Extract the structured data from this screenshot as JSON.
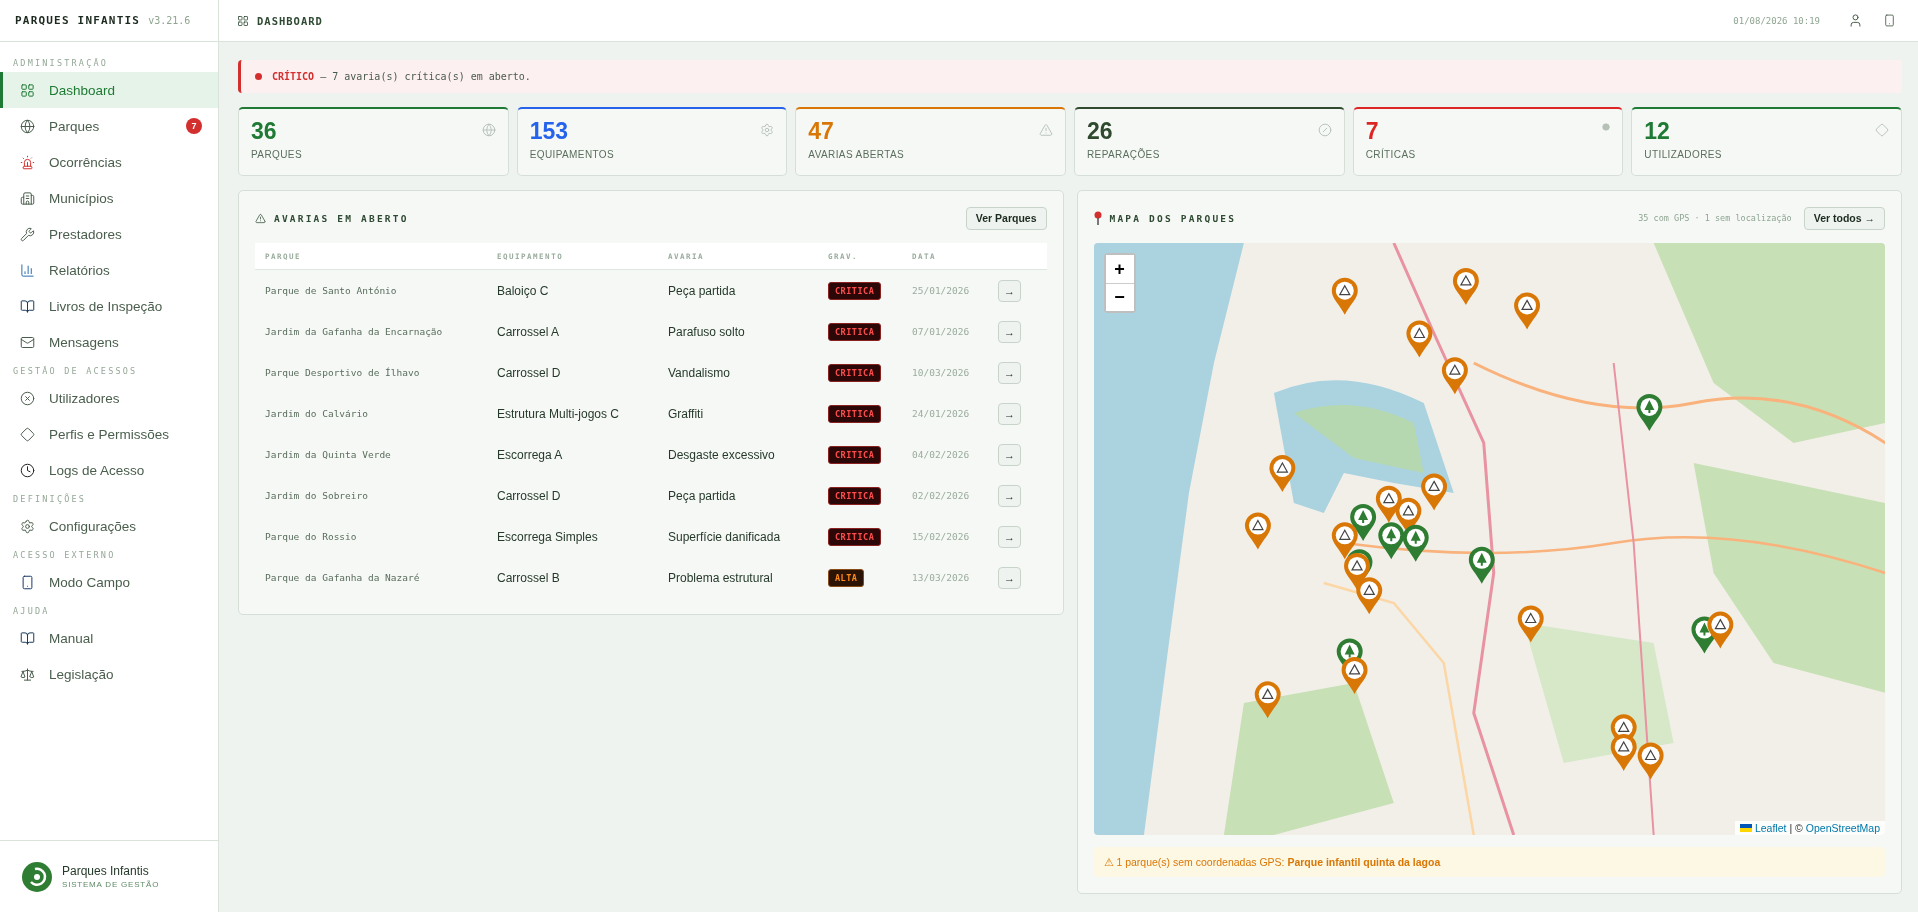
{
  "brand": {
    "title": "PARQUES INFANTIS",
    "version": "v3.21.6"
  },
  "sidebar": {
    "sections": [
      {
        "label": "ADMINISTRAÇÃO",
        "items": [
          {
            "label": "Dashboard",
            "selected": true
          },
          {
            "label": "Parques",
            "selected": false,
            "badge": "7"
          },
          {
            "label": "Ocorrências",
            "selected": false
          },
          {
            "label": "Municípios",
            "selected": false
          },
          {
            "label": "Prestadores",
            "selected": false
          },
          {
            "label": "Relatórios",
            "selected": false
          },
          {
            "label": "Livros de Inspeção",
            "selected": false
          },
          {
            "label": "Mensagens",
            "selected": false
          }
        ]
      },
      {
        "label": "GESTÃO DE ACESSOS",
        "items": [
          {
            "label": "Utilizadores",
            "selected": false
          },
          {
            "label": "Perfis e Permissões",
            "selected": false
          },
          {
            "label": "Logs de Acesso",
            "selected": false
          }
        ]
      },
      {
        "label": "DEFINIÇÕES",
        "items": [
          {
            "label": "Configurações",
            "selected": false
          }
        ]
      },
      {
        "label": "ACESSO EXTERNO",
        "items": [
          {
            "label": "Modo Campo",
            "selected": false
          }
        ]
      },
      {
        "label": "AJUDA",
        "items": [
          {
            "label": "Manual",
            "selected": false
          },
          {
            "label": "Legislação",
            "selected": false
          }
        ]
      }
    ]
  },
  "logo": {
    "name": "Parques Infantis",
    "tagline": "SISTEMA DE GESTÃO"
  },
  "topbar": {
    "title": "DASHBOARD",
    "datetime": "01/08/2026 10:19"
  },
  "alert": {
    "text": "**CRÍTICO** — 7 avaria(s) crítica(s) em aberto."
  },
  "stats": [
    {
      "value": "36",
      "label": "PARQUES",
      "color": "#1e7a34"
    },
    {
      "value": "153",
      "label": "EQUIPAMENTOS",
      "color": "#2563eb"
    },
    {
      "value": "47",
      "label": "AVARIAS ABERTAS",
      "color": "#d97706"
    },
    {
      "value": "26",
      "label": "REPARAÇÕES",
      "color": "#2f4a2f"
    },
    {
      "value": "7",
      "label": "CRÍTICAS",
      "color": "#dc2626"
    },
    {
      "value": "12",
      "label": "UTILIZADORES",
      "color": "#1e7a34"
    }
  ],
  "faults": {
    "title": "AVARIAS EM ABERTO",
    "button": "Ver Parques",
    "columns": [
      "PARQUE",
      "EQUIPAMENTO",
      "AVARIA",
      "GRAV.",
      "DATA"
    ],
    "rows": [
      {
        "park": "Parque de Santo António",
        "equipment": "Baloiço C",
        "fault": "Peça partida",
        "severity": "CRITICA",
        "kind": "critical",
        "date": "25/01/2026",
        "action": "→"
      },
      {
        "park": "Jardim da Gafanha da Encarnação",
        "equipment": "Carrossel A",
        "fault": "Parafuso solto",
        "severity": "CRITICA",
        "kind": "critical",
        "date": "07/01/2026",
        "action": "→"
      },
      {
        "park": "Parque Desportivo de Ílhavo",
        "equipment": "Carrossel D",
        "fault": "Vandalismo",
        "severity": "CRITICA",
        "kind": "critical",
        "date": "10/03/2026",
        "action": "→"
      },
      {
        "park": "Jardim do Calvário",
        "equipment": "Estrutura Multi-jogos C",
        "fault": "Graffiti",
        "severity": "CRITICA",
        "kind": "critical",
        "date": "24/01/2026",
        "action": "→"
      },
      {
        "park": "Jardim da Quinta Verde",
        "equipment": "Escorrega A",
        "fault": "Desgaste excessivo",
        "severity": "CRITICA",
        "kind": "critical",
        "date": "04/02/2026",
        "action": "→"
      },
      {
        "park": "Jardim do Sobreiro",
        "equipment": "Carrossel D",
        "fault": "Peça partida",
        "severity": "CRITICA",
        "kind": "critical",
        "date": "02/02/2026",
        "action": "→"
      },
      {
        "park": "Parque do Rossio",
        "equipment": "Escorrega Simples",
        "fault": "Superfície danificada",
        "severity": "CRITICA",
        "kind": "critical",
        "date": "15/02/2026",
        "action": "→"
      },
      {
        "park": "Parque da Gafanha da Nazaré",
        "equipment": "Carrossel B",
        "fault": "Problema estrutural",
        "severity": "ALTA",
        "kind": "high",
        "date": "13/03/2026",
        "action": "→"
      }
    ]
  },
  "map": {
    "title": "MAPA DOS PARQUES",
    "info": "35 com GPS · 1 sem localização",
    "button": "Ver todos →",
    "zoom_in": "+",
    "zoom_out": "−",
    "attribution_link": "Leaflet",
    "attribution_sep": "| ©",
    "attribution_source": "OpenStreetMap",
    "warning": "⚠ 1 parque(s) sem coordenadas GPS: **Parque infantil quinta da lagoa**"
  }
}
